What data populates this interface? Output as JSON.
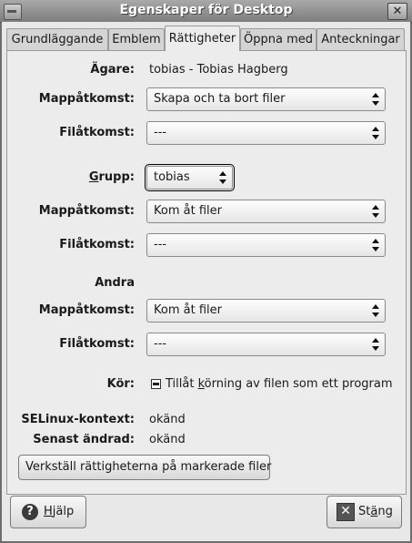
{
  "window": {
    "title": "Egenskaper för Desktop",
    "close_glyph": "✕"
  },
  "tabs": [
    {
      "label": "Grundläggande",
      "active": false
    },
    {
      "label": "Emblem",
      "active": false
    },
    {
      "label": "Rättigheter",
      "active": true
    },
    {
      "label": "Öppna med",
      "active": false
    },
    {
      "label": "Anteckningar",
      "active": false
    }
  ],
  "owner": {
    "label": "Ägare:",
    "value": "tobias - Tobias Hagberg"
  },
  "owner_folder": {
    "label": "Mappåtkomst:",
    "value": "Skapa och ta bort filer"
  },
  "owner_file": {
    "label": "Filåtkomst:",
    "value": "---"
  },
  "group": {
    "label_prefix": "",
    "label_underline": "G",
    "label_rest": "rupp:",
    "value": "tobias"
  },
  "group_folder": {
    "label": "Mappåtkomst:",
    "value": "Kom åt filer"
  },
  "group_file": {
    "label": "Filåtkomst:",
    "value": "---"
  },
  "others": {
    "heading": "Andra"
  },
  "others_folder": {
    "label": "Mappåtkomst:",
    "value": "Kom åt filer"
  },
  "others_file": {
    "label": "Filåtkomst:",
    "value": "---"
  },
  "execute": {
    "label": "Kör:",
    "check_pre": "Tillåt ",
    "check_ul": "k",
    "check_post": "örning av filen som ett program",
    "state": "inconsistent"
  },
  "selinux": {
    "label": "SELinux-kontext:",
    "value": "okänd"
  },
  "modified": {
    "label": "Senast ändrad:",
    "value": "okänd"
  },
  "apply_button": "Verkställ rättigheterna på markerade filer",
  "help_button": {
    "ul": "H",
    "rest": "jälp",
    "icon": "?"
  },
  "close_button": {
    "pre": "St",
    "ul": "ä",
    "rest": "ng",
    "icon": "✕"
  }
}
